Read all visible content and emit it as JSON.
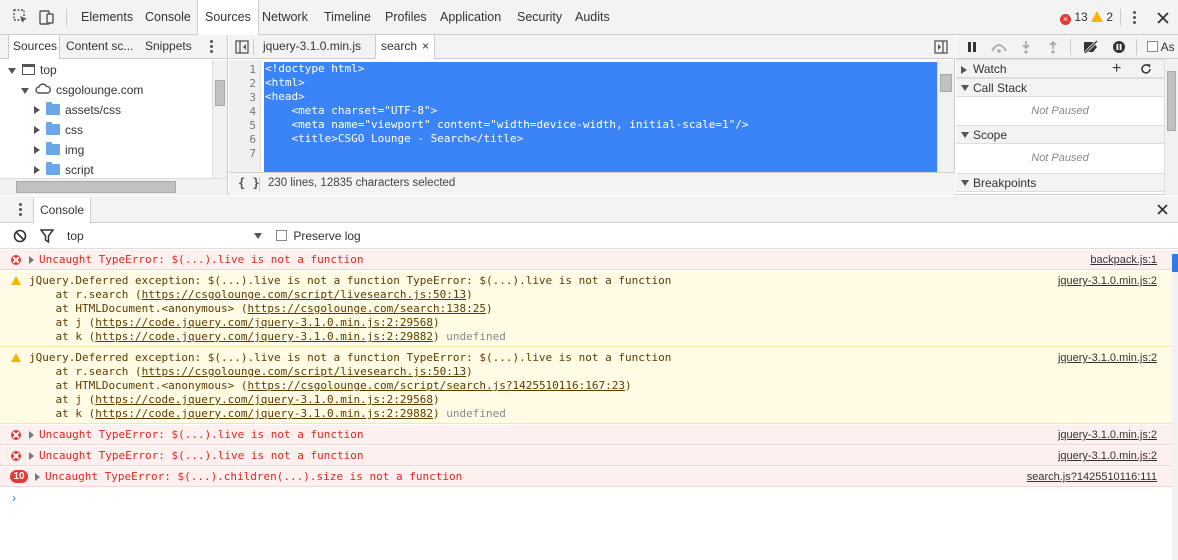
{
  "toolbar": {
    "tabs": [
      "Elements",
      "Console",
      "Sources",
      "Network",
      "Timeline",
      "Profiles",
      "Application",
      "Security",
      "Audits"
    ],
    "active_tab": "Sources",
    "error_count": "13",
    "warning_count": "2"
  },
  "navigator": {
    "tabs": [
      "Sources",
      "Content sc...",
      "Snippets"
    ],
    "tree": [
      {
        "label": "top",
        "depth": 0,
        "kind": "frame",
        "open": true
      },
      {
        "label": "csgolounge.com",
        "depth": 1,
        "kind": "cloud",
        "open": true
      },
      {
        "label": "assets/css",
        "depth": 2,
        "kind": "folder",
        "open": false
      },
      {
        "label": "css",
        "depth": 2,
        "kind": "folder",
        "open": false
      },
      {
        "label": "img",
        "depth": 2,
        "kind": "folder",
        "open": false
      },
      {
        "label": "script",
        "depth": 2,
        "kind": "folder",
        "open": false
      }
    ]
  },
  "editor": {
    "tabs": [
      {
        "label": "jquery-3.1.0.min.js",
        "active": false
      },
      {
        "label": "search",
        "active": true
      }
    ],
    "lines": [
      {
        "n": "1",
        "text": "<!doctype html>"
      },
      {
        "n": "2",
        "text": "<html>"
      },
      {
        "n": "3",
        "text": "<head>"
      },
      {
        "n": "4",
        "text": "    <meta charset=\"UTF-8\">"
      },
      {
        "n": "5",
        "text": "    <meta name=\"viewport\" content=\"width=device-width, initial-scale=1\"/>"
      },
      {
        "n": "6",
        "text": "    <title>CSGO Lounge - Search</title>"
      },
      {
        "n": "7",
        "text": ""
      }
    ],
    "pretty_print": "{ }",
    "status": "230 lines, 12835 characters selected"
  },
  "debugger": {
    "panes": [
      {
        "title": "Watch",
        "body": ""
      },
      {
        "title": "Call Stack",
        "body": "Not Paused"
      },
      {
        "title": "Scope",
        "body": "Not Paused"
      },
      {
        "title": "Breakpoints",
        "body": ""
      }
    ],
    "async_label": "As"
  },
  "drawer": {
    "tab": "Console",
    "context": "top",
    "preserve_log": "Preserve log"
  },
  "messages": [
    {
      "level": "error",
      "lines": [
        "Uncaught TypeError: $(...).live is not a function"
      ],
      "source": "backpack.js:1"
    },
    {
      "level": "warning",
      "lines": [
        "jQuery.Deferred exception: $(...).live is not a function TypeError: $(...).live is not a function",
        "    at r.search (https://csgolounge.com/script/livesearch.js:50:13)",
        "    at HTMLDocument.<anonymous> (https://csgolounge.com/search:138:25)",
        "    at j (https://code.jquery.com/jquery-3.1.0.min.js:2:29568)",
        "    at k (https://code.jquery.com/jquery-3.1.0.min.js:2:29882) undefined"
      ],
      "source": "jquery-3.1.0.min.js:2"
    },
    {
      "level": "warning",
      "lines": [
        "jQuery.Deferred exception: $(...).live is not a function TypeError: $(...).live is not a function",
        "    at r.search (https://csgolounge.com/script/livesearch.js:50:13)",
        "    at HTMLDocument.<anonymous> (https://csgolounge.com/script/search.js?1425510116:167:23)",
        "    at j (https://code.jquery.com/jquery-3.1.0.min.js:2:29568)",
        "    at k (https://code.jquery.com/jquery-3.1.0.min.js:2:29882) undefined"
      ],
      "source": "jquery-3.1.0.min.js:2"
    },
    {
      "level": "error",
      "lines": [
        "Uncaught TypeError: $(...).live is not a function"
      ],
      "source": "jquery-3.1.0.min.js:2"
    },
    {
      "level": "error",
      "lines": [
        "Uncaught TypeError: $(...).live is not a function"
      ],
      "source": "jquery-3.1.0.min.js:2"
    },
    {
      "level": "error",
      "count": "10",
      "lines": [
        "Uncaught TypeError: $(...).children(...).size is not a function"
      ],
      "source": "search.js?1425510116:111"
    }
  ],
  "prompt_symbol": "›",
  "colors": {
    "accent": "#2d7de2",
    "selection": "#3b84f7",
    "error": "#e53935",
    "warning": "#f5b400"
  }
}
